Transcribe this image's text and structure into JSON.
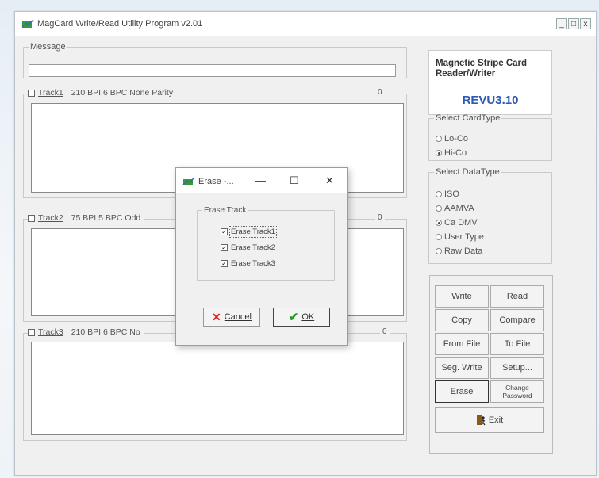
{
  "window": {
    "title": "MagCard Write/Read Utility Program v2.01",
    "min": "_",
    "max": "□",
    "close": "x"
  },
  "message": {
    "legend": "Message",
    "value": ""
  },
  "tracks": [
    {
      "label": "Track1",
      "spec": "210 BPI 6 BPC None Parity",
      "count": "0"
    },
    {
      "label": "Track2",
      "spec": "75 BPI 5 BPC Odd",
      "count": "0"
    },
    {
      "label": "Track3",
      "spec": "210 BPI 6 BPC No",
      "count": "0"
    }
  ],
  "brand": {
    "title_line1": "Magnetic Stripe Card",
    "title_line2": "Reader/Writer",
    "version": "REVU3.10"
  },
  "card_type": {
    "legend": "Select CardType",
    "options": [
      {
        "label": "Lo-Co",
        "selected": false
      },
      {
        "label": "Hi-Co",
        "selected": true
      }
    ]
  },
  "data_type": {
    "legend": "Select DataType",
    "options": [
      {
        "label": "ISO",
        "selected": false
      },
      {
        "label": "AAMVA",
        "selected": false
      },
      {
        "label": "Ca DMV",
        "selected": true
      },
      {
        "label": "User Type",
        "selected": false
      },
      {
        "label": "Raw Data",
        "selected": false
      }
    ]
  },
  "buttons": {
    "write": "Write",
    "read": "Read",
    "copy": "Copy",
    "compare": "Compare",
    "from_file": "From File",
    "to_file": "To File",
    "seg_write": "Seg. Write",
    "setup": "Setup...",
    "erase": "Erase",
    "change_password_1": "Change",
    "change_password_2": "Password",
    "exit": "Exit"
  },
  "dialog": {
    "title": "Erase -...",
    "min": "—",
    "max": "☐",
    "close": "✕",
    "group_legend": "Erase Track",
    "checks": [
      {
        "label": "Erase Track1",
        "checked": true
      },
      {
        "label": "Erase Track2",
        "checked": true
      },
      {
        "label": "Erase Track3",
        "checked": true
      }
    ],
    "cancel": "Cancel",
    "ok": "OK"
  },
  "colors": {
    "version": "#2d5ab3",
    "cancel_x": "#d22",
    "ok_check": "#2a9a2a",
    "icon_green": "#3a9a3a"
  }
}
